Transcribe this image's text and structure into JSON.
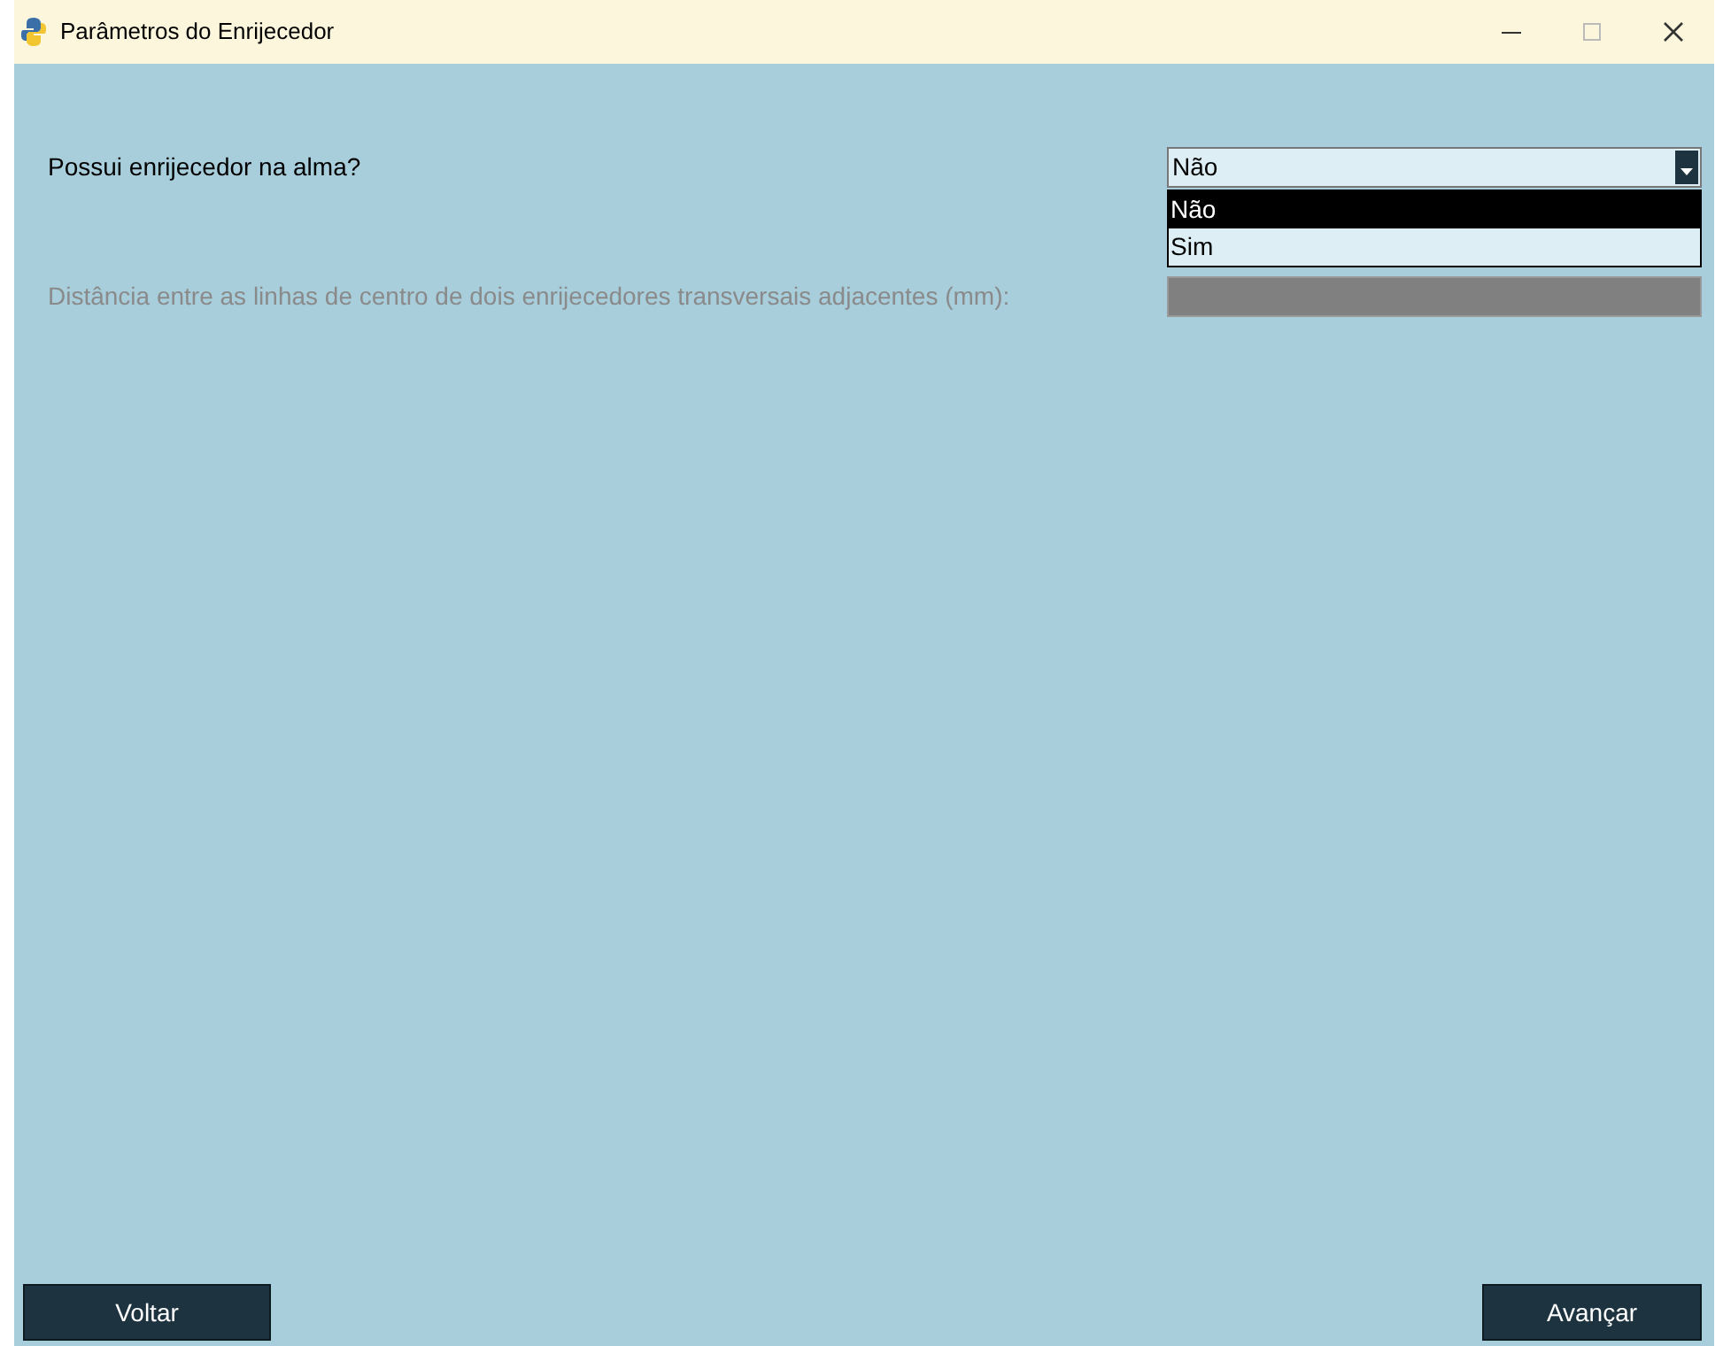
{
  "window": {
    "title": "Parâmetros do Enrijecedor"
  },
  "stiffener_question": {
    "label": "Possui enrijecedor na alma?",
    "value": "Não",
    "expanded": true,
    "options": [
      {
        "label": "Não",
        "selected": true
      },
      {
        "label": "Sim",
        "selected": false
      }
    ]
  },
  "distance": {
    "label": "Distância entre as linhas de centro de dois enrijecedores transversais adjacentes (mm):",
    "disabled": true
  },
  "buttons": [
    {
      "label": "Voltar"
    },
    {
      "label": "Avançar"
    }
  ]
}
